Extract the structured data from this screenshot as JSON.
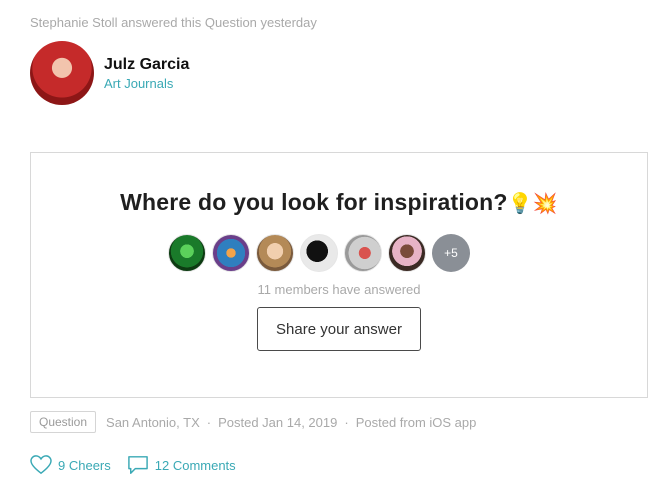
{
  "activity_text": "Stephanie Stoll answered this Question yesterday",
  "author": {
    "name": "Julz Garcia",
    "group": "Art Journals",
    "avatar_icon": "profile-photo"
  },
  "question": {
    "title": "Where do you look for inspiration?",
    "emoji": "💡💥",
    "more_count": "+5",
    "answered_text": "11 members have answered",
    "share_label": "Share your answer"
  },
  "meta": {
    "tag": "Question",
    "location": "San Antonio, TX",
    "posted": "Posted Jan 14, 2019",
    "source": "Posted from iOS app",
    "separator": "·"
  },
  "actions": {
    "cheers": "9 Cheers",
    "comments": "12 Comments"
  },
  "colors": {
    "accent": "#3aa9b5",
    "muted": "#a9a9a9",
    "border": "#d8d8d8"
  }
}
